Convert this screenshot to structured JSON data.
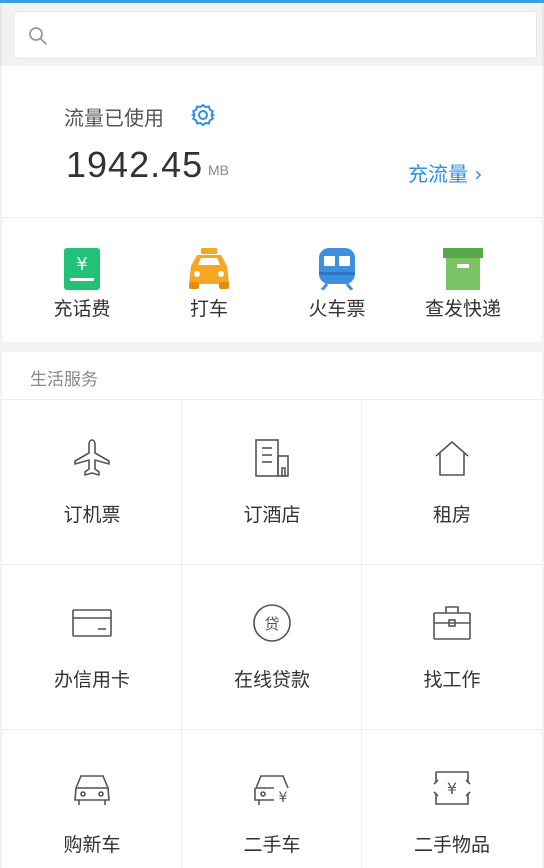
{
  "search": {
    "placeholder": "",
    "icon": "search-icon"
  },
  "traffic": {
    "label": "流量已使用",
    "value": "1942.45",
    "unit": "MB",
    "recharge_label": "充流量 ›"
  },
  "quick_actions": [
    {
      "label": "充话费",
      "icon": "phone-bill-icon"
    },
    {
      "label": "打车",
      "icon": "taxi-icon"
    },
    {
      "label": "火车票",
      "icon": "train-icon"
    },
    {
      "label": "查发快递",
      "icon": "package-icon"
    }
  ],
  "services": {
    "title": "生活服务",
    "items": [
      {
        "label": "订机票",
        "icon": "airplane-icon"
      },
      {
        "label": "订酒店",
        "icon": "hotel-icon"
      },
      {
        "label": "租房",
        "icon": "house-icon"
      },
      {
        "label": "办信用卡",
        "icon": "credit-card-icon"
      },
      {
        "label": "在线贷款",
        "icon": "loan-icon"
      },
      {
        "label": "找工作",
        "icon": "briefcase-icon"
      },
      {
        "label": "购新车",
        "icon": "car-icon"
      },
      {
        "label": "二手车",
        "icon": "used-car-icon"
      },
      {
        "label": "二手物品",
        "icon": "used-goods-icon"
      }
    ]
  },
  "colors": {
    "accent": "#2d8fdd",
    "top_bar": "#3aa0e0"
  }
}
